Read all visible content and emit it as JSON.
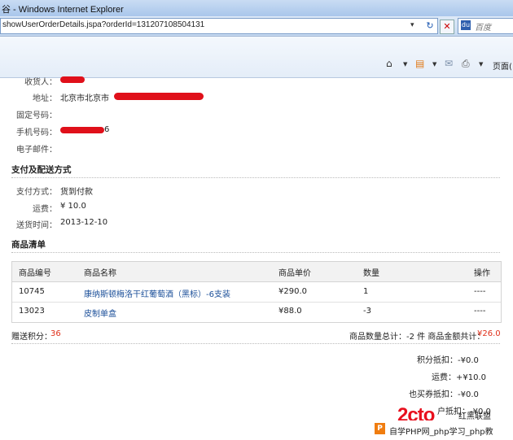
{
  "window": {
    "title": "谷 - Windows Internet Explorer"
  },
  "address": {
    "url": "showUserOrderDetails.jspa?orderId=131207108504131",
    "search_placeholder": "百度"
  },
  "toolbar": {
    "page_menu": "页面("
  },
  "consignee": {
    "recipient_label": "收货人：",
    "address_label": "地址：",
    "address_value": "北京市北京市",
    "phone_label": "固定号码：",
    "mobile_label": "手机号码：",
    "mobile_value": "6",
    "email_label": "电子邮件："
  },
  "payment": {
    "section_title": "支付及配送方式",
    "method_label": "支付方式：",
    "method_value": "货到付款",
    "shipping_label": "运费：",
    "shipping_value": "¥ 10.0",
    "delivery_label": "送货时间：",
    "delivery_value": "2013-12-10"
  },
  "products": {
    "section_title": "商品清单",
    "headers": [
      "商品编号",
      "商品名称",
      "商品单价",
      "数量",
      "操作"
    ],
    "rows": [
      {
        "id": "10745",
        "name": "康纳斯顿梅洛干红葡萄酒（黑标）-6支装",
        "price": "¥290.0",
        "qty": "1",
        "action": "----"
      },
      {
        "id": "13023",
        "name": "皮制单盒",
        "price": "¥88.0",
        "qty": "-3",
        "action": "----"
      }
    ]
  },
  "summary": {
    "points_label": "赠送积分：",
    "points_value": "36",
    "total_label": "商品数量总计：-2 件 商品金额共计：",
    "total_value": "¥26.0",
    "lines": [
      "积分抵扣：-¥0.0",
      "运费：+¥10.0",
      "也买券抵扣：-¥0.0",
      "户抵扣：-¥0.0"
    ]
  },
  "watermark": {
    "logo": "2cto",
    "logo_label": "红黑联盟",
    "banner": "自学PHP网_php学习_php教"
  }
}
